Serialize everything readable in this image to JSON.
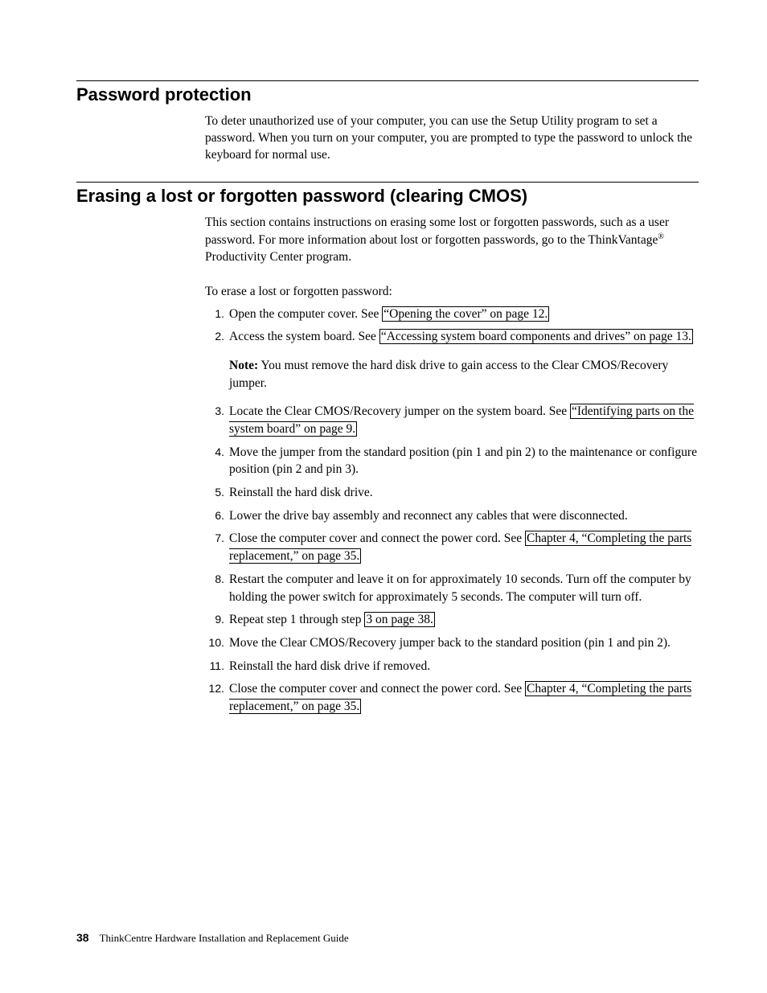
{
  "section1": {
    "heading": "Password protection",
    "para": "To deter unauthorized use of your computer, you can use the Setup Utility program to set a password. When you turn on your computer, you are prompted to type the password to unlock the keyboard for normal use."
  },
  "section2": {
    "heading": "Erasing a lost or forgotten password (clearing CMOS)",
    "para1_a": "This section contains instructions on erasing some lost or forgotten passwords, such as a user password. For more information about lost or forgotten passwords, go to the ThinkVantage",
    "para1_b": " Productivity Center program.",
    "para2": "To erase a lost or forgotten password:",
    "steps": {
      "s1_a": "Open the computer cover. See ",
      "s1_link": "“Opening the cover” on page 12.",
      "s2_a": "Access the system board. See ",
      "s2_link": "“Accessing system board components and drives” on page 13.",
      "s2_note_label": "Note:",
      "s2_note": " You must remove the hard disk drive to gain access to the Clear CMOS/Recovery jumper.",
      "s3_a": "Locate the Clear CMOS/Recovery jumper on the system board. See ",
      "s3_link": "“Identifying parts on the system board” on page 9.",
      "s4": "Move the jumper from the standard position (pin 1 and pin 2) to the maintenance or configure position (pin 2 and pin 3).",
      "s5": "Reinstall the hard disk drive.",
      "s6": "Lower the drive bay assembly and reconnect any cables that were disconnected.",
      "s7_a": "Close the computer cover and connect the power cord. See ",
      "s7_link": "Chapter 4, “Completing the parts replacement,” on page 35.",
      "s8": "Restart the computer and leave it on for approximately 10 seconds. Turn off the computer by holding the power switch for approximately 5 seconds. The computer will turn off.",
      "s9_a": "Repeat step 1 through step ",
      "s9_link": "3 on page 38.",
      "s10": "Move the Clear CMOS/Recovery jumper back to the standard position (pin 1 and pin 2).",
      "s11": "Reinstall the hard disk drive if removed.",
      "s12_a": "Close the computer cover and connect the power cord. See ",
      "s12_link": "Chapter 4, “Completing the parts replacement,” on page 35."
    }
  },
  "footer": {
    "page": "38",
    "title": "ThinkCentre Hardware Installation and Replacement Guide"
  },
  "reg": "®"
}
